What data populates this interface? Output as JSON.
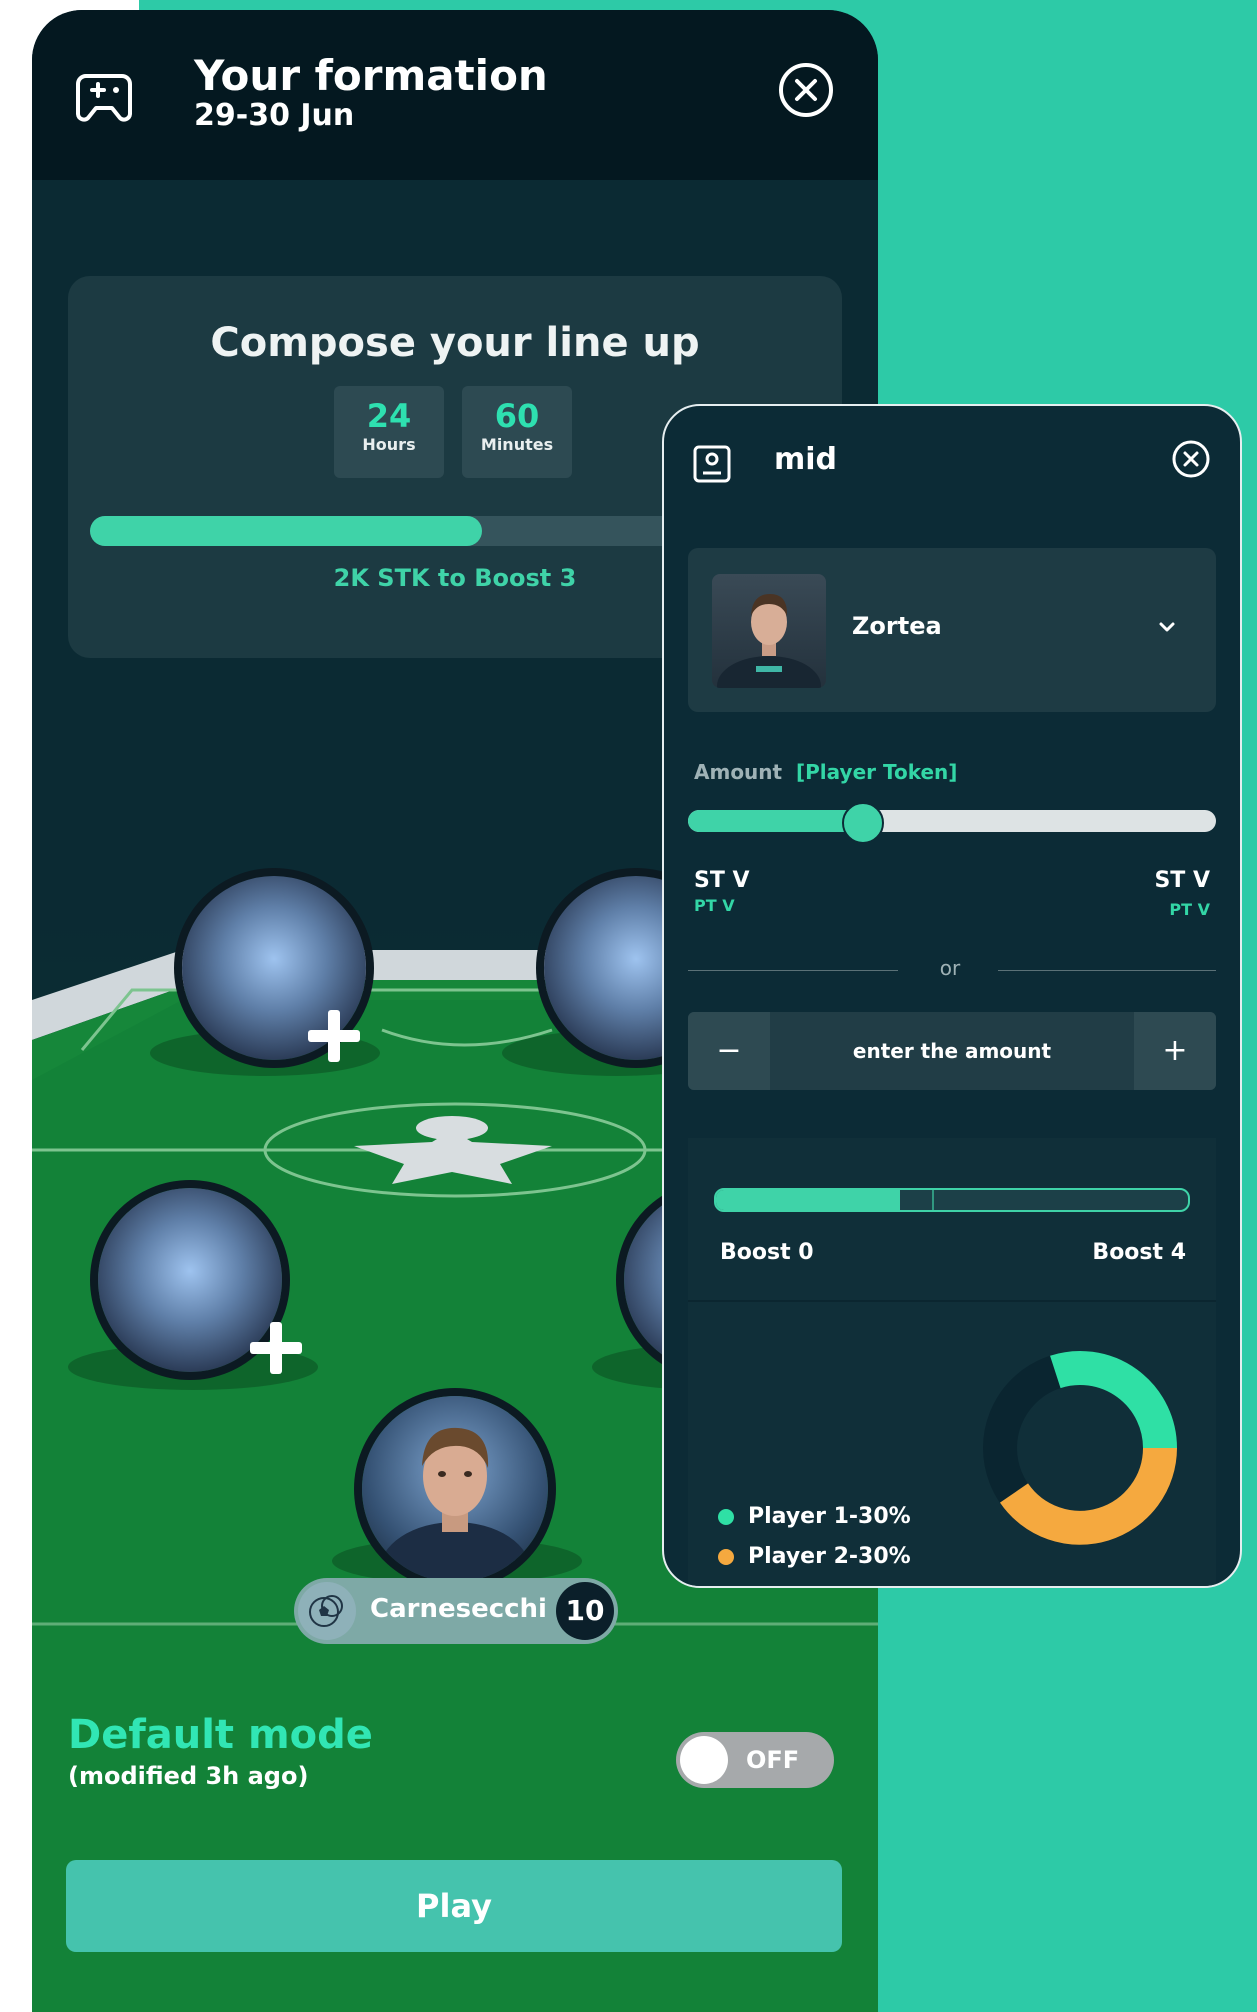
{
  "header": {
    "title": "Your formation",
    "subtitle": "29-30 Jun"
  },
  "compose": {
    "title": "Compose your line up",
    "timers": [
      {
        "value": "24",
        "label": "Hours"
      },
      {
        "value": "60",
        "label": "Minutes"
      }
    ],
    "progress_fraction": 0.53,
    "boost_text": "2K STK to Boost 3"
  },
  "featured_player": {
    "name": "Carnesecchi",
    "number": "10"
  },
  "mode": {
    "title": "Default mode",
    "subtitle": "(modified 3h ago)",
    "toggle_label": "OFF"
  },
  "play_label": "Play",
  "overlay": {
    "title": "mid",
    "selected_player": "Zortea",
    "amount_label": "Amount",
    "amount_token": "[Player Token]",
    "slider_fraction": 0.33,
    "range_left": {
      "st": "ST V",
      "pt": "PT V"
    },
    "range_right": {
      "st": "ST V",
      "pt": "PT V"
    },
    "or_text": "or",
    "stepper": {
      "minus": "−",
      "placeholder": "enter the amount",
      "plus": "+"
    },
    "boost": {
      "fill_fraction": 0.39,
      "left_label": "Boost 0",
      "right_label": "Boost 4"
    },
    "legend": [
      {
        "label": "Player 1-30%",
        "color": "#2fe0a5"
      },
      {
        "label": "Player 2-30%",
        "color": "#f5a93f"
      }
    ]
  },
  "colors": {
    "accent": "#3fd3a8",
    "background": "#2dcaa7",
    "panel": "#0b2a33",
    "orange": "#f5a93f"
  }
}
